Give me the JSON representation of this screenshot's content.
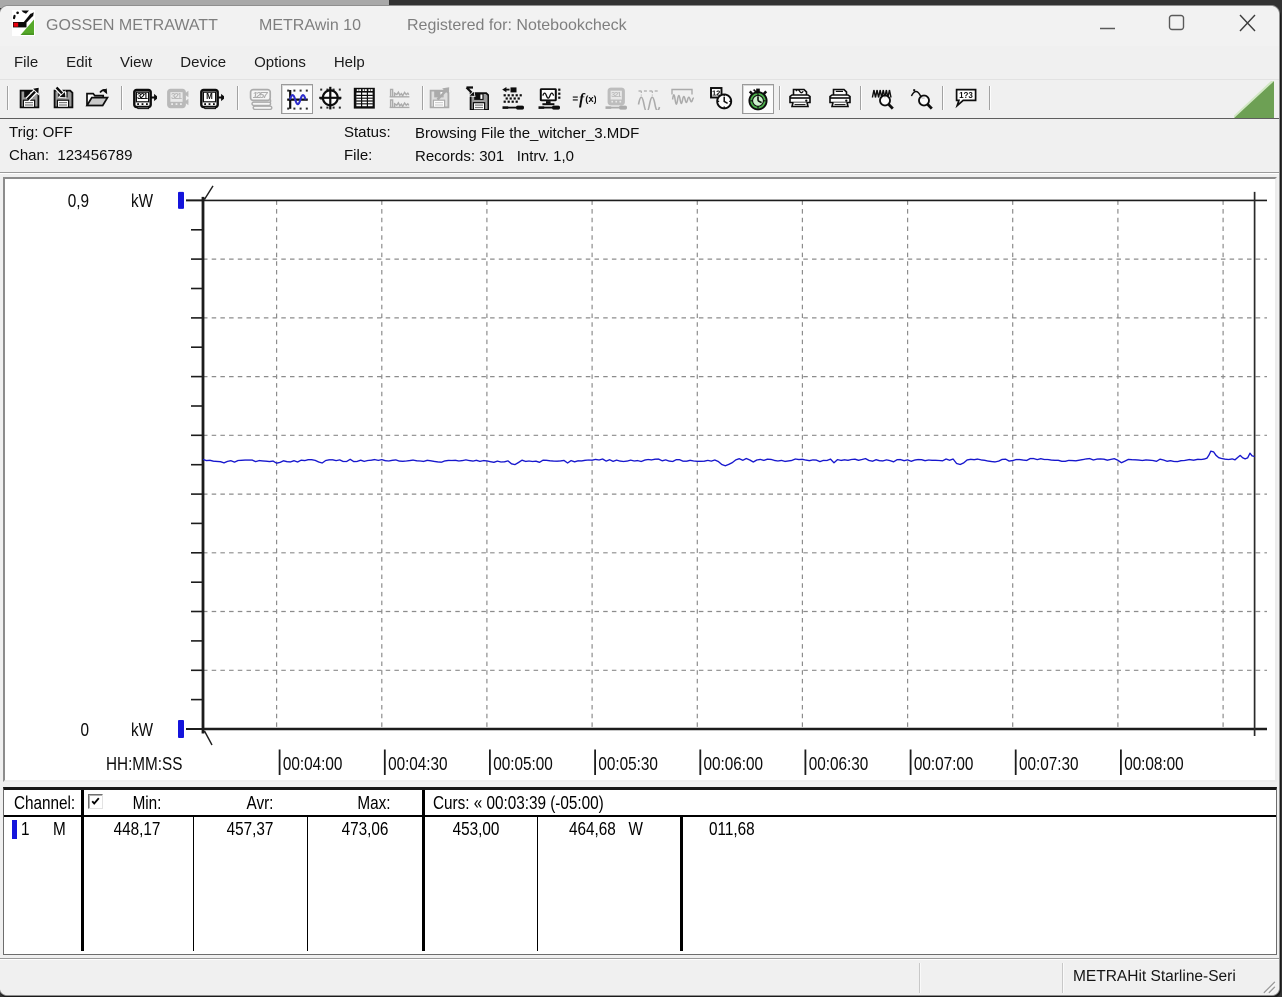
{
  "window": {
    "title_app": "GOSSEN METRAWATT",
    "title_program": "METRAwin 10",
    "title_registered": "Registered for: Notebookcheck",
    "controls": [
      "minimize",
      "maximize",
      "close"
    ]
  },
  "menu": {
    "items": [
      "File",
      "Edit",
      "View",
      "Device",
      "Options",
      "Help"
    ]
  },
  "toolbar": {
    "buttons": [
      {
        "icon": "separator"
      },
      {
        "icon": "save-export-icon",
        "state": "normal"
      },
      {
        "icon": "save-import-icon",
        "state": "normal"
      },
      {
        "icon": "open-file-icon",
        "state": "normal"
      },
      {
        "icon": "separator"
      },
      {
        "icon": "device-read-icon",
        "state": "normal"
      },
      {
        "icon": "device-sync-icon",
        "state": "disabled"
      },
      {
        "icon": "device-memory-icon",
        "state": "normal"
      },
      {
        "icon": "separator"
      },
      {
        "icon": "view-digital-icon",
        "state": "disabled"
      },
      {
        "icon": "view-chart-icon",
        "state": "pressed"
      },
      {
        "icon": "view-xy-icon",
        "state": "normal"
      },
      {
        "icon": "view-table-icon",
        "state": "normal"
      },
      {
        "icon": "view-stats-icon",
        "state": "disabled"
      },
      {
        "icon": "separator"
      },
      {
        "icon": "export-data-icon",
        "state": "disabled"
      },
      {
        "icon": "store-data-icon",
        "state": "normal"
      },
      {
        "icon": "channel-config-icon",
        "state": "normal"
      },
      {
        "icon": "monitor-config-icon",
        "state": "normal"
      },
      {
        "icon": "formula-icon",
        "state": "normal"
      },
      {
        "icon": "device-config-icon",
        "state": "disabled"
      },
      {
        "icon": "wave-icon",
        "state": "disabled"
      },
      {
        "icon": "damped-wave-icon",
        "state": "disabled"
      },
      {
        "icon": "time-setup-icon",
        "state": "normal"
      },
      {
        "icon": "timer-icon",
        "state": "pressed"
      },
      {
        "icon": "separator"
      },
      {
        "icon": "print-chart-icon",
        "state": "normal"
      },
      {
        "icon": "print-icon",
        "state": "normal"
      },
      {
        "icon": "separator"
      },
      {
        "icon": "zoom-in-icon",
        "state": "normal"
      },
      {
        "icon": "zoom-out-icon",
        "state": "normal"
      },
      {
        "icon": "separator"
      },
      {
        "icon": "comment-icon",
        "state": "normal"
      },
      {
        "icon": "separator"
      }
    ],
    "brand_triangle_color": "#6da054"
  },
  "status_panel": {
    "trig_label": "Trig:",
    "trig_value": "OFF",
    "chan_label": "Chan:",
    "chan_value": "123456789",
    "status_label": "Status:",
    "status_value": "Browsing File the_witcher_3.MDF",
    "file_label": "File:",
    "file_value": "Records: 301   Intrv. 1,0"
  },
  "chart_data": {
    "type": "line",
    "title": "",
    "xlabel": "HH:MM:SS",
    "ylabel": "kW",
    "y_top_label": "0,9",
    "y_bottom_label": "0",
    "y_unit": "kW",
    "ylim": [
      0,
      0.9
    ],
    "x_start_time": "00:03:39",
    "x_tick_labels": [
      "00:04:00",
      "00:04:30",
      "00:05:00",
      "00:05:30",
      "00:06:00",
      "00:06:30",
      "00:07:00",
      "00:07:30",
      "00:08:00"
    ],
    "x_tick_seconds": [
      21,
      51,
      81,
      111,
      141,
      171,
      201,
      231,
      261,
      291
    ],
    "x_span_seconds": 300,
    "series_name": "Channel 1 Power (W)",
    "series_color": "#1616cd",
    "points_t_w": [
      [
        0.0,
        458.94
      ],
      [
        1.0,
        456.95
      ],
      [
        2.0,
        457.41
      ],
      [
        3.0,
        456.04
      ],
      [
        4.0,
        455.7
      ],
      [
        5.0,
        455.11
      ],
      [
        6.0,
        453.08
      ],
      [
        7.0,
        455.63
      ],
      [
        8.0,
        456.83
      ],
      [
        9.0,
        454.49
      ],
      [
        10.0,
        457.18
      ],
      [
        11.0,
        457.51
      ],
      [
        12.0,
        457.81
      ],
      [
        13.0,
        457.78
      ],
      [
        14.0,
        458.07
      ],
      [
        15.0,
        455.26
      ],
      [
        16.0,
        457.03
      ],
      [
        17.0,
        456.51
      ],
      [
        18.0,
        456.03
      ],
      [
        19.0,
        455.23
      ],
      [
        20.0,
        456.1
      ],
      [
        21.0,
        452.6
      ],
      [
        22.0,
        453.92
      ],
      [
        23.0,
        456.6
      ],
      [
        24.0,
        455.1
      ],
      [
        25.0,
        454.71
      ],
      [
        26.0,
        456.8
      ],
      [
        27.0,
        454.66
      ],
      [
        28.0,
        457.59
      ],
      [
        29.0,
        456.95
      ],
      [
        30.0,
        458.56
      ],
      [
        31.0,
        458.55
      ],
      [
        32.0,
        457.31
      ],
      [
        33.0,
        454.58
      ],
      [
        34.0,
        452.9
      ],
      [
        35.0,
        457.19
      ],
      [
        36.0,
        458.36
      ],
      [
        37.0,
        458.37
      ],
      [
        38.0,
        457.02
      ],
      [
        39.0,
        458.1
      ],
      [
        40.0,
        455.4
      ],
      [
        41.0,
        455.6
      ],
      [
        42.0,
        459.17
      ],
      [
        43.0,
        455.2
      ],
      [
        44.0,
        455.56
      ],
      [
        45.0,
        457.62
      ],
      [
        46.0,
        455.65
      ],
      [
        47.0,
        457.23
      ],
      [
        48.0,
        457.73
      ],
      [
        49.0,
        458.69
      ],
      [
        50.0,
        457.39
      ],
      [
        51.0,
        458.74
      ],
      [
        52.0,
        456.86
      ],
      [
        53.0,
        456.28
      ],
      [
        54.0,
        457.56
      ],
      [
        55.0,
        458.16
      ],
      [
        56.0,
        456.14
      ],
      [
        57.0,
        455.81
      ],
      [
        58.0,
        456.33
      ],
      [
        59.0,
        456.97
      ],
      [
        60.0,
        457.82
      ],
      [
        61.0,
        456.6
      ],
      [
        62.0,
        456.28
      ],
      [
        63.0,
        455.69
      ],
      [
        64.0,
        457.43
      ],
      [
        65.0,
        456.63
      ],
      [
        66.0,
        455.69
      ],
      [
        67.0,
        454.7
      ],
      [
        68.0,
        454.18
      ],
      [
        69.0,
        456.53
      ],
      [
        70.0,
        457.31
      ],
      [
        71.0,
        457.21
      ],
      [
        72.0,
        457.52
      ],
      [
        73.0,
        456.38
      ],
      [
        74.0,
        456.98
      ],
      [
        75.0,
        458.21
      ],
      [
        76.0,
        456.94
      ],
      [
        77.0,
        456.19
      ],
      [
        78.0,
        457.46
      ],
      [
        79.0,
        455.55
      ],
      [
        80.0,
        456.98
      ],
      [
        81.0,
        456.44
      ],
      [
        82.0,
        455.08
      ],
      [
        83.0,
        454.11
      ],
      [
        84.0,
        456.11
      ],
      [
        85.0,
        454.66
      ],
      [
        86.0,
        455.0
      ],
      [
        87.0,
        456.44
      ],
      [
        88.0,
        451.6
      ],
      [
        89.0,
        450.2
      ],
      [
        90.0,
        453.8
      ],
      [
        91.0,
        457.61
      ],
      [
        92.0,
        455.64
      ],
      [
        93.0,
        456.34
      ],
      [
        94.0,
        455.47
      ],
      [
        95.0,
        455.9
      ],
      [
        96.0,
        454.13
      ],
      [
        97.0,
        457.74
      ],
      [
        98.0,
        457.51
      ],
      [
        99.0,
        456.7
      ],
      [
        100.0,
        456.17
      ],
      [
        101.0,
        455.9
      ],
      [
        102.0,
        456.47
      ],
      [
        103.0,
        457.31
      ],
      [
        104.0,
        452.9
      ],
      [
        105.0,
        457.03
      ],
      [
        106.0,
        454.92
      ],
      [
        107.0,
        456.65
      ],
      [
        108.0,
        456.46
      ],
      [
        109.0,
        457.41
      ],
      [
        110.0,
        458.0
      ],
      [
        111.0,
        457.64
      ],
      [
        112.0,
        459.06
      ],
      [
        113.0,
        457.98
      ],
      [
        114.0,
        459.75
      ],
      [
        115.0,
        456.2
      ],
      [
        116.0,
        458.53
      ],
      [
        117.0,
        455.56
      ],
      [
        118.0,
        457.79
      ],
      [
        119.0,
        456.21
      ],
      [
        120.0,
        455.41
      ],
      [
        121.0,
        456.05
      ],
      [
        122.0,
        457.81
      ],
      [
        123.0,
        456.25
      ],
      [
        124.0,
        456.94
      ],
      [
        125.0,
        455.52
      ],
      [
        126.0,
        457.9
      ],
      [
        127.0,
        458.86
      ],
      [
        128.0,
        458.1
      ],
      [
        129.0,
        459.29
      ],
      [
        130.0,
        459.49
      ],
      [
        131.0,
        456.57
      ],
      [
        132.0,
        458.17
      ],
      [
        133.0,
        456.14
      ],
      [
        134.0,
        455.53
      ],
      [
        135.0,
        458.52
      ],
      [
        136.0,
        458.57
      ],
      [
        137.0,
        455.92
      ],
      [
        138.0,
        455.96
      ],
      [
        139.0,
        457.46
      ],
      [
        140.0,
        456.23
      ],
      [
        141.0,
        455.84
      ],
      [
        142.0,
        455.78
      ],
      [
        143.0,
        455.91
      ],
      [
        144.0,
        457.29
      ],
      [
        145.0,
        456.19
      ],
      [
        146.0,
        458.06
      ],
      [
        147.0,
        455.48
      ],
      [
        148.0,
        450.4
      ],
      [
        149.0,
        448.17
      ],
      [
        150.0,
        450.5
      ],
      [
        151.0,
        453.6
      ],
      [
        152.0,
        458.24
      ],
      [
        153.0,
        460.2
      ],
      [
        154.0,
        457.41
      ],
      [
        155.0,
        460.58
      ],
      [
        156.0,
        458.06
      ],
      [
        157.0,
        454.57
      ],
      [
        158.0,
        457.95
      ],
      [
        159.0,
        458.98
      ],
      [
        160.0,
        457.28
      ],
      [
        161.0,
        459.29
      ],
      [
        162.0,
        459.07
      ],
      [
        163.0,
        457.38
      ],
      [
        164.0,
        456.3
      ],
      [
        165.0,
        457.38
      ],
      [
        166.0,
        455.65
      ],
      [
        167.0,
        456.47
      ],
      [
        168.0,
        457.3
      ],
      [
        169.0,
        459.77
      ],
      [
        170.0,
        458.6
      ],
      [
        171.0,
        459.15
      ],
      [
        172.0,
        457.85
      ],
      [
        173.0,
        456.88
      ],
      [
        174.0,
        458.13
      ],
      [
        175.0,
        457.85
      ],
      [
        176.0,
        455.2
      ],
      [
        177.0,
        457.24
      ],
      [
        178.0,
        457.17
      ],
      [
        179.0,
        459.47
      ],
      [
        180.0,
        453.2
      ],
      [
        181.0,
        458.73
      ],
      [
        182.0,
        457.4
      ],
      [
        183.0,
        458.39
      ],
      [
        184.0,
        457.54
      ],
      [
        185.0,
        458.93
      ],
      [
        186.0,
        459.38
      ],
      [
        187.0,
        457.47
      ],
      [
        188.0,
        458.83
      ],
      [
        189.0,
        460.37
      ],
      [
        190.0,
        457.2
      ],
      [
        191.0,
        455.91
      ],
      [
        192.0,
        458.47
      ],
      [
        193.0,
        456.74
      ],
      [
        194.0,
        456.51
      ],
      [
        195.0,
        458.11
      ],
      [
        196.0,
        456.95
      ],
      [
        197.0,
        454.88
      ],
      [
        198.0,
        458.49
      ],
      [
        199.0,
        458.69
      ],
      [
        200.0,
        456.83
      ],
      [
        201.0,
        458.14
      ],
      [
        202.0,
        455.85
      ],
      [
        203.0,
        457.84
      ],
      [
        204.0,
        458.61
      ],
      [
        205.0,
        458.45
      ],
      [
        206.0,
        456.79
      ],
      [
        207.0,
        457.98
      ],
      [
        208.0,
        457.43
      ],
      [
        209.0,
        457.46
      ],
      [
        210.0,
        457.2
      ],
      [
        211.0,
        456.56
      ],
      [
        212.0,
        459.63
      ],
      [
        213.0,
        457.56
      ],
      [
        214.0,
        459.65
      ],
      [
        215.0,
        452.0
      ],
      [
        216.0,
        450.3
      ],
      [
        217.0,
        453.0
      ],
      [
        218.0,
        458.2
      ],
      [
        219.0,
        459.22
      ],
      [
        220.0,
        458.44
      ],
      [
        221.0,
        459.49
      ],
      [
        222.0,
        458.25
      ],
      [
        223.0,
        457.5
      ],
      [
        224.0,
        456.11
      ],
      [
        225.0,
        455.33
      ],
      [
        226.0,
        454.7
      ],
      [
        227.0,
        456.14
      ],
      [
        228.0,
        459.1
      ],
      [
        229.0,
        459.44
      ],
      [
        230.0,
        456.16
      ],
      [
        231.0,
        456.9
      ],
      [
        232.0,
        458.84
      ],
      [
        233.0,
        458.75
      ],
      [
        234.0,
        457.77
      ],
      [
        235.0,
        457.29
      ],
      [
        236.0,
        460.49
      ],
      [
        237.0,
        460.37
      ],
      [
        238.0,
        458.69
      ],
      [
        239.0,
        460.17
      ],
      [
        240.0,
        458.79
      ],
      [
        241.0,
        458.88
      ],
      [
        242.0,
        457.84
      ],
      [
        243.0,
        457.51
      ],
      [
        244.0,
        457.56
      ],
      [
        245.0,
        455.72
      ],
      [
        246.0,
        455.83
      ],
      [
        247.0,
        457.38
      ],
      [
        248.0,
        457.02
      ],
      [
        249.0,
        456.7
      ],
      [
        250.0,
        457.59
      ],
      [
        251.0,
        458.71
      ],
      [
        252.0,
        459.85
      ],
      [
        253.0,
        460.34
      ],
      [
        254.0,
        458.06
      ],
      [
        255.0,
        459.52
      ],
      [
        256.0,
        459.91
      ],
      [
        257.0,
        459.41
      ],
      [
        258.0,
        457.59
      ],
      [
        259.0,
        458.97
      ],
      [
        260.0,
        460.27
      ],
      [
        261.0,
        457.52
      ],
      [
        262.0,
        453.4
      ],
      [
        263.0,
        456.17
      ],
      [
        264.0,
        458.96
      ],
      [
        265.0,
        458.54
      ],
      [
        266.0,
        458.37
      ],
      [
        267.0,
        457.81
      ],
      [
        268.0,
        457.23
      ],
      [
        269.0,
        458.11
      ],
      [
        270.0,
        457.74
      ],
      [
        271.0,
        457.13
      ],
      [
        272.0,
        455.79
      ],
      [
        273.0,
        459.28
      ],
      [
        274.0,
        458.0
      ],
      [
        275.0,
        455.71
      ],
      [
        276.0,
        456.83
      ],
      [
        277.0,
        455.43
      ],
      [
        278.0,
        455.25
      ],
      [
        279.0,
        456.73
      ],
      [
        280.0,
        457.19
      ],
      [
        281.4,
        458.6
      ],
      [
        282.6,
        457.6
      ],
      [
        283.8,
        459.2
      ],
      [
        284.8,
        458.8
      ],
      [
        285.6,
        459.5
      ],
      [
        286.4,
        461.0
      ],
      [
        287.0,
        466.5
      ],
      [
        287.5,
        473.06
      ],
      [
        288.3,
        471.8
      ],
      [
        289.0,
        466.0
      ],
      [
        289.8,
        462.0
      ],
      [
        290.6,
        460.5
      ],
      [
        291.6,
        459.4
      ],
      [
        292.6,
        458.8
      ],
      [
        293.6,
        459.9
      ],
      [
        294.4,
        458.4
      ],
      [
        295.2,
        462.5
      ],
      [
        295.9,
        465.8
      ],
      [
        296.6,
        461.8
      ],
      [
        297.3,
        459.8
      ],
      [
        298.0,
        461.5
      ],
      [
        298.7,
        469.5
      ],
      [
        299.3,
        465.0
      ],
      [
        300.0,
        463.9
      ]
    ],
    "grid": true,
    "marker_color": "#1414dc"
  },
  "stats_table": {
    "channel_label": "Channel:",
    "checkbox_checked": true,
    "headers": [
      "Min:",
      "Avr:",
      "Max:"
    ],
    "cursor_header": "Curs: « 00:03:39 (-05:00)",
    "row": {
      "channel": "1",
      "mode": "M",
      "min": "448,17",
      "avr": "457,37",
      "max": "473,06",
      "curs1": "453,00",
      "curs2": "464,68   W",
      "delta": "011,68"
    }
  },
  "status_bar": {
    "device_text": "METRAHit Starline-Seri"
  }
}
